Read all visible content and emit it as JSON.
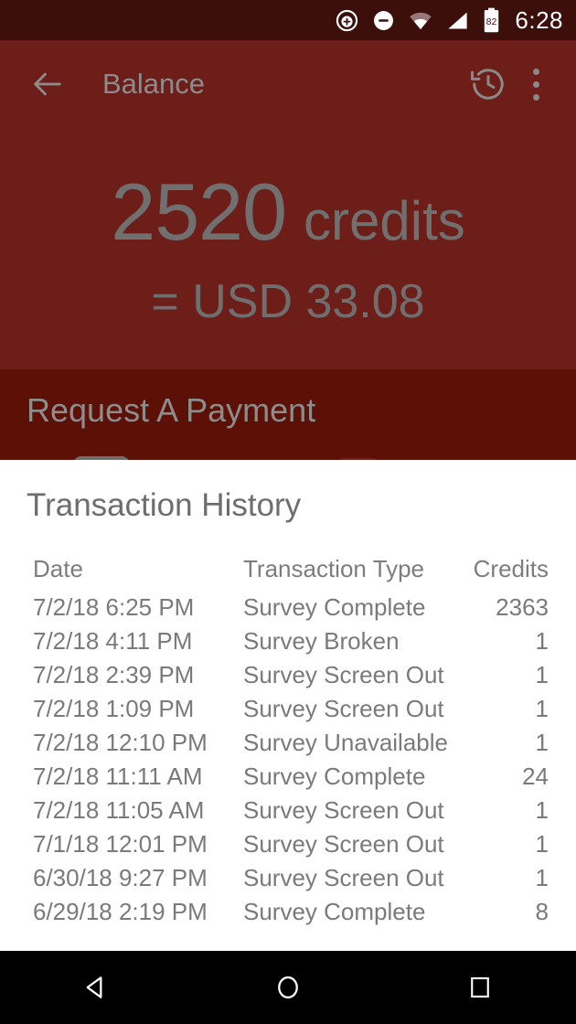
{
  "statusbar": {
    "time": "6:28",
    "battery_level": "82",
    "icons": [
      "add-circle-icon",
      "do-not-disturb-icon",
      "wifi-icon",
      "signal-icon",
      "battery-icon"
    ]
  },
  "appbar": {
    "title": "Balance",
    "back_icon": "arrow-back-icon",
    "history_icon": "history-icon",
    "overflow_icon": "overflow-menu-icon"
  },
  "balance": {
    "amount": "2520",
    "unit": "credits",
    "converted": "= USD 33.08"
  },
  "request_payment": {
    "title": "Request A Payment"
  },
  "history": {
    "title": "Transaction History",
    "columns": {
      "date": "Date",
      "type": "Transaction Type",
      "credits": "Credits"
    },
    "rows": [
      {
        "date": "7/2/18 6:25 PM",
        "type": "Survey Complete",
        "credits": "2363"
      },
      {
        "date": "7/2/18 4:11 PM",
        "type": "Survey Broken",
        "credits": "1"
      },
      {
        "date": "7/2/18 2:39 PM",
        "type": "Survey Screen Out",
        "credits": "1"
      },
      {
        "date": "7/2/18 1:09 PM",
        "type": "Survey Screen Out",
        "credits": "1"
      },
      {
        "date": "7/2/18 12:10 PM",
        "type": "Survey Unavailable",
        "credits": "1"
      },
      {
        "date": "7/2/18 11:11 AM",
        "type": "Survey Complete",
        "credits": "24"
      },
      {
        "date": "7/2/18 11:05 AM",
        "type": "Survey Screen Out",
        "credits": "1"
      },
      {
        "date": "7/1/18 12:01 PM",
        "type": "Survey Screen Out",
        "credits": "1"
      },
      {
        "date": "6/30/18 9:27 PM",
        "type": "Survey Screen Out",
        "credits": "1"
      },
      {
        "date": "6/29/18 2:19 PM",
        "type": "Survey Complete",
        "credits": "8"
      }
    ]
  },
  "navbar": {
    "back_icon": "nav-back-icon",
    "home_icon": "nav-home-icon",
    "recents_icon": "nav-recents-icon"
  },
  "colors": {
    "statusbar": "#3d0f0b",
    "appbar": "#6e1e19",
    "hero": "#6e1e19",
    "request_band": "#5c1006",
    "content": "#ffffff",
    "navbar": "#000000",
    "muted_text": "#7a7a7a"
  }
}
